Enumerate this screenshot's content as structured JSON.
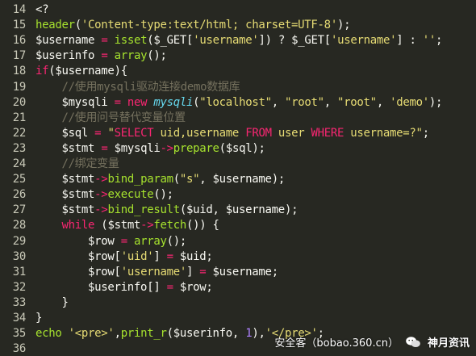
{
  "editor": {
    "background": "#272822",
    "lines": [
      {
        "num": "14",
        "tokens": [
          [
            "pl",
            "<?"
          ]
        ]
      },
      {
        "num": "15",
        "tokens": [
          [
            "fn",
            "header"
          ],
          [
            "pl",
            "("
          ],
          [
            "str",
            "'Content-type:text/html; charset=UTF-8'"
          ],
          [
            "pl",
            ");"
          ]
        ]
      },
      {
        "num": "16",
        "tokens": [
          [
            "var",
            "$username"
          ],
          [
            "pl",
            " "
          ],
          [
            "op",
            "="
          ],
          [
            "pl",
            " "
          ],
          [
            "fn",
            "isset"
          ],
          [
            "pl",
            "("
          ],
          [
            "var",
            "$_GET"
          ],
          [
            "pl",
            "["
          ],
          [
            "str",
            "'username'"
          ],
          [
            "pl",
            "]) ? "
          ],
          [
            "var",
            "$_GET"
          ],
          [
            "pl",
            "["
          ],
          [
            "str",
            "'username'"
          ],
          [
            "pl",
            "] : "
          ],
          [
            "str",
            "''"
          ],
          [
            "pl",
            ";"
          ]
        ]
      },
      {
        "num": "17",
        "tokens": [
          [
            "var",
            "$userinfo"
          ],
          [
            "pl",
            " "
          ],
          [
            "op",
            "="
          ],
          [
            "pl",
            " "
          ],
          [
            "fn",
            "array"
          ],
          [
            "pl",
            "();"
          ]
        ]
      },
      {
        "num": "18",
        "tokens": [
          [
            "kw",
            "if"
          ],
          [
            "pl",
            "("
          ],
          [
            "var",
            "$username"
          ],
          [
            "pl",
            "){"
          ]
        ]
      },
      {
        "num": "19",
        "tokens": [
          [
            "pl",
            "    "
          ],
          [
            "com",
            "//使用mysqli驱动连接demo数据库"
          ]
        ]
      },
      {
        "num": "20",
        "tokens": [
          [
            "pl",
            "    "
          ],
          [
            "var",
            "$mysqli"
          ],
          [
            "pl",
            " "
          ],
          [
            "op",
            "="
          ],
          [
            "pl",
            " "
          ],
          [
            "kw",
            "new"
          ],
          [
            "pl",
            " "
          ],
          [
            "cls",
            "mysqli"
          ],
          [
            "pl",
            "("
          ],
          [
            "str",
            "\"localhost\""
          ],
          [
            "pl",
            ", "
          ],
          [
            "str",
            "\"root\""
          ],
          [
            "pl",
            ", "
          ],
          [
            "str",
            "\"root\""
          ],
          [
            "pl",
            ", "
          ],
          [
            "str",
            "'demo'"
          ],
          [
            "pl",
            ");"
          ]
        ]
      },
      {
        "num": "21",
        "tokens": [
          [
            "pl",
            "    "
          ],
          [
            "com",
            "//使用问号替代变量位置"
          ]
        ]
      },
      {
        "num": "22",
        "tokens": [
          [
            "pl",
            "    "
          ],
          [
            "var",
            "$sql"
          ],
          [
            "pl",
            " "
          ],
          [
            "op",
            "="
          ],
          [
            "pl",
            " "
          ],
          [
            "str",
            "\""
          ],
          [
            "kw",
            "SELECT"
          ],
          [
            "str",
            " uid,username "
          ],
          [
            "kw",
            "FROM"
          ],
          [
            "str",
            " user "
          ],
          [
            "kw",
            "WHERE"
          ],
          [
            "str",
            " username=?\""
          ],
          [
            "pl",
            ";"
          ]
        ]
      },
      {
        "num": "23",
        "tokens": [
          [
            "pl",
            "    "
          ],
          [
            "var",
            "$stmt"
          ],
          [
            "pl",
            " "
          ],
          [
            "op",
            "="
          ],
          [
            "pl",
            " "
          ],
          [
            "var",
            "$mysqli"
          ],
          [
            "op",
            "->"
          ],
          [
            "fn",
            "prepare"
          ],
          [
            "pl",
            "("
          ],
          [
            "var",
            "$sql"
          ],
          [
            "pl",
            ");"
          ]
        ]
      },
      {
        "num": "24",
        "tokens": [
          [
            "pl",
            "    "
          ],
          [
            "com",
            "//绑定变量"
          ]
        ]
      },
      {
        "num": "25",
        "tokens": [
          [
            "pl",
            "    "
          ],
          [
            "var",
            "$stmt"
          ],
          [
            "op",
            "->"
          ],
          [
            "fn",
            "bind_param"
          ],
          [
            "pl",
            "("
          ],
          [
            "str",
            "\"s\""
          ],
          [
            "pl",
            ", "
          ],
          [
            "var",
            "$username"
          ],
          [
            "pl",
            ");"
          ]
        ]
      },
      {
        "num": "26",
        "tokens": [
          [
            "pl",
            "    "
          ],
          [
            "var",
            "$stmt"
          ],
          [
            "op",
            "->"
          ],
          [
            "fn",
            "execute"
          ],
          [
            "pl",
            "();"
          ]
        ]
      },
      {
        "num": "27",
        "tokens": [
          [
            "pl",
            "    "
          ],
          [
            "var",
            "$stmt"
          ],
          [
            "op",
            "->"
          ],
          [
            "fn",
            "bind_result"
          ],
          [
            "pl",
            "("
          ],
          [
            "var",
            "$uid"
          ],
          [
            "pl",
            ", "
          ],
          [
            "var",
            "$username"
          ],
          [
            "pl",
            ");"
          ]
        ]
      },
      {
        "num": "28",
        "tokens": [
          [
            "pl",
            "    "
          ],
          [
            "kw",
            "while"
          ],
          [
            "pl",
            " ("
          ],
          [
            "var",
            "$stmt"
          ],
          [
            "op",
            "->"
          ],
          [
            "fn",
            "fetch"
          ],
          [
            "pl",
            "()) {"
          ]
        ]
      },
      {
        "num": "29",
        "tokens": [
          [
            "pl",
            "        "
          ],
          [
            "var",
            "$row"
          ],
          [
            "pl",
            " "
          ],
          [
            "op",
            "="
          ],
          [
            "pl",
            " "
          ],
          [
            "fn",
            "array"
          ],
          [
            "pl",
            "();"
          ]
        ]
      },
      {
        "num": "30",
        "tokens": [
          [
            "pl",
            "        "
          ],
          [
            "var",
            "$row"
          ],
          [
            "pl",
            "["
          ],
          [
            "str",
            "'uid'"
          ],
          [
            "pl",
            "] "
          ],
          [
            "op",
            "="
          ],
          [
            "pl",
            " "
          ],
          [
            "var",
            "$uid"
          ],
          [
            "pl",
            ";"
          ]
        ]
      },
      {
        "num": "31",
        "tokens": [
          [
            "pl",
            "        "
          ],
          [
            "var",
            "$row"
          ],
          [
            "pl",
            "["
          ],
          [
            "str",
            "'username'"
          ],
          [
            "pl",
            "] "
          ],
          [
            "op",
            "="
          ],
          [
            "pl",
            " "
          ],
          [
            "var",
            "$username"
          ],
          [
            "pl",
            ";"
          ]
        ]
      },
      {
        "num": "32",
        "tokens": [
          [
            "pl",
            "        "
          ],
          [
            "var",
            "$userinfo"
          ],
          [
            "pl",
            "[] "
          ],
          [
            "op",
            "="
          ],
          [
            "pl",
            " "
          ],
          [
            "var",
            "$row"
          ],
          [
            "pl",
            ";"
          ]
        ]
      },
      {
        "num": "33",
        "tokens": [
          [
            "pl",
            "    }"
          ]
        ]
      },
      {
        "num": "34",
        "tokens": [
          [
            "pl",
            "}"
          ]
        ]
      },
      {
        "num": "35",
        "tokens": [
          [
            "fn",
            "echo"
          ],
          [
            "pl",
            " "
          ],
          [
            "str",
            "'<pre>'"
          ],
          [
            "pl",
            ","
          ],
          [
            "fn",
            "print_r"
          ],
          [
            "pl",
            "("
          ],
          [
            "var",
            "$userinfo"
          ],
          [
            "pl",
            ", "
          ],
          [
            "num",
            "1"
          ],
          [
            "pl",
            "),"
          ],
          [
            "str",
            "'</pre>'"
          ],
          [
            "pl",
            ";"
          ]
        ]
      },
      {
        "num": "36",
        "tokens": [
          [
            "pl",
            ""
          ]
        ]
      }
    ]
  },
  "watermark": {
    "site": "安全客（bobao.360.cn）",
    "icon": "wechat-icon",
    "brand": "神月资讯"
  }
}
